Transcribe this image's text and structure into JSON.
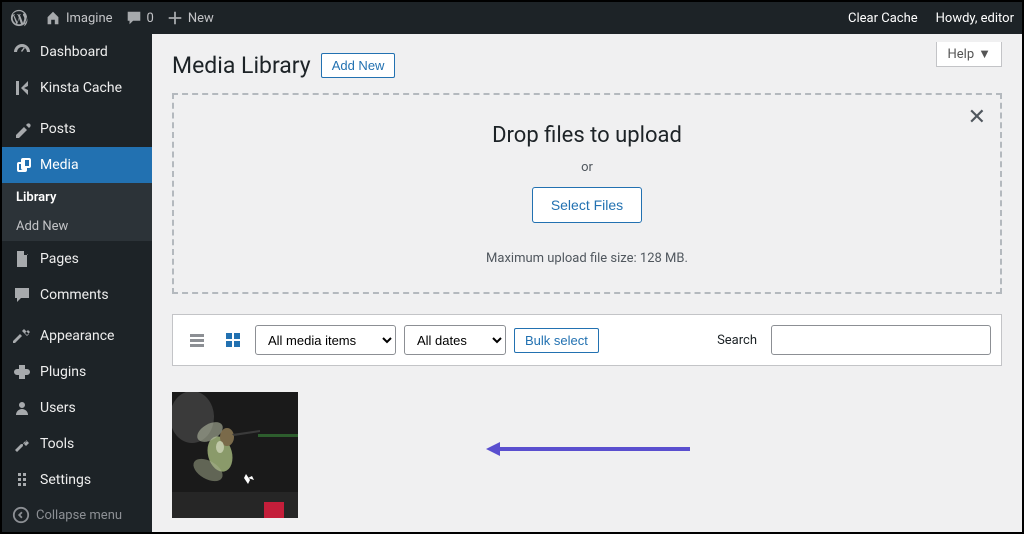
{
  "adminbar": {
    "site_name": "Imagine",
    "comments_count": "0",
    "new_label": "New",
    "clear_cache": "Clear Cache",
    "howdy": "Howdy, editor"
  },
  "sidebar": {
    "dashboard": "Dashboard",
    "kinsta_cache": "Kinsta Cache",
    "posts": "Posts",
    "media": "Media",
    "media_sub_library": "Library",
    "media_sub_addnew": "Add New",
    "pages": "Pages",
    "comments": "Comments",
    "appearance": "Appearance",
    "plugins": "Plugins",
    "users": "Users",
    "tools": "Tools",
    "settings": "Settings",
    "collapse": "Collapse menu"
  },
  "page": {
    "help": "Help",
    "title": "Media Library",
    "add_new": "Add New"
  },
  "dropzone": {
    "title": "Drop files to upload",
    "or": "or",
    "select": "Select Files",
    "max": "Maximum upload file size: 128 MB."
  },
  "filter": {
    "media_items": "All media items",
    "dates": "All dates",
    "bulk_select": "Bulk select",
    "search_label": "Search"
  }
}
